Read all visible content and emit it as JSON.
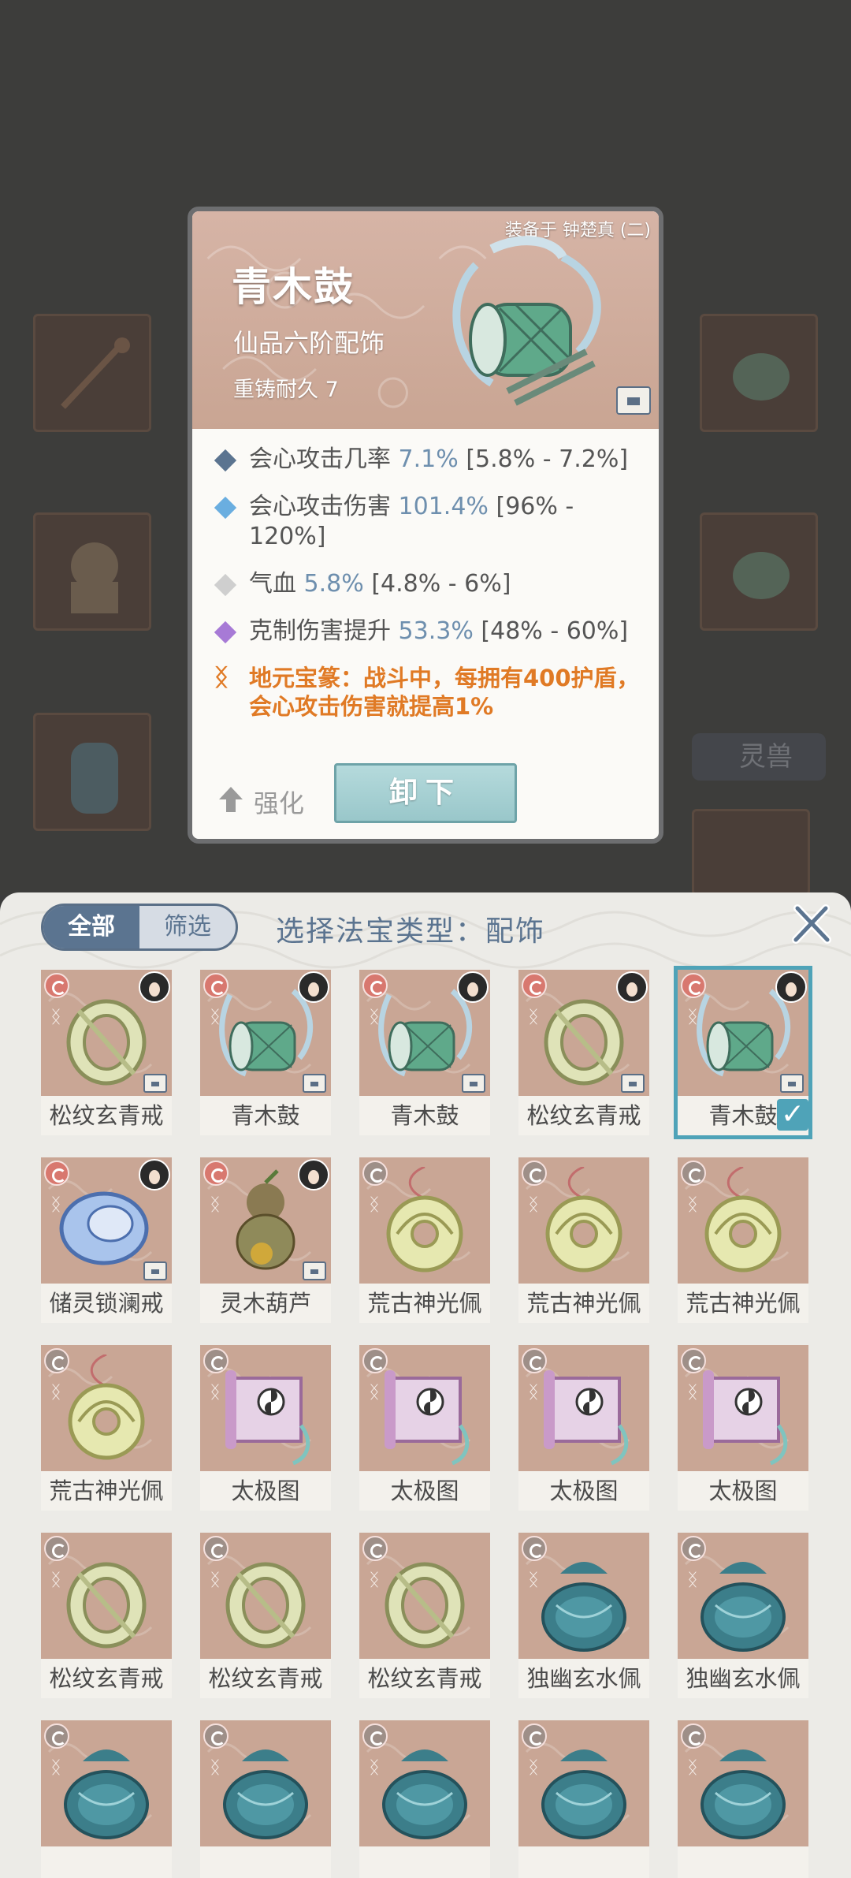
{
  "colors": {
    "accent_blue": "#5b7490",
    "stat_value_blue": "#6e8fae",
    "special_orange": "#e07a25",
    "selected_border": "#4fa3b8",
    "card_header": "#c9a593"
  },
  "background": {
    "beast_button_label": "灵兽"
  },
  "card": {
    "equipped_on": "装备于 钟楚真 (二)",
    "name": "青木鼓",
    "grade": "仙品六阶配饰",
    "durability": "重铸耐久 7",
    "stats": [
      {
        "name": "会心攻击几率",
        "value": "7.1%",
        "range": "[5.8% - 7.2%]",
        "gem": "#5b7490"
      },
      {
        "name": "会心攻击伤害",
        "value": "101.4%",
        "range": "[96% - 120%]",
        "gem": "#6aaee0"
      },
      {
        "name": "气血",
        "value": "5.8%",
        "range": "[4.8% - 6%]",
        "gem": "#cfcfcf"
      },
      {
        "name": "克制伤害提升",
        "value": "53.3%",
        "range": "[48% - 60%]",
        "gem": "#a77ad6"
      }
    ],
    "special_effect": "地元宝篆：战斗中，每拥有400护盾，会心攻击伤害就提高1%",
    "enhance_label": "强化",
    "unequip_label": "卸下"
  },
  "panel": {
    "tabs": [
      {
        "label": "全部",
        "active": true
      },
      {
        "label": "筛选",
        "active": false
      }
    ],
    "title": "选择法宝类型：配饰",
    "items": [
      {
        "name": "松纹玄青戒",
        "kind": "ring",
        "equipped": true,
        "locked": true,
        "selected": false
      },
      {
        "name": "青木鼓",
        "kind": "drum",
        "equipped": true,
        "locked": true,
        "selected": false
      },
      {
        "name": "青木鼓",
        "kind": "drum",
        "equipped": true,
        "locked": true,
        "selected": false
      },
      {
        "name": "松纹玄青戒",
        "kind": "ring",
        "equipped": true,
        "locked": true,
        "selected": false
      },
      {
        "name": "青木鼓",
        "kind": "drum",
        "equipped": true,
        "locked": true,
        "selected": true
      },
      {
        "name": "储灵锁澜戒",
        "kind": "bluering",
        "equipped": true,
        "locked": true,
        "selected": false
      },
      {
        "name": "灵木葫芦",
        "kind": "gourd",
        "equipped": true,
        "locked": true,
        "selected": false
      },
      {
        "name": "荒古神光佩",
        "kind": "pendant",
        "equipped": false,
        "locked": false,
        "selected": false
      },
      {
        "name": "荒古神光佩",
        "kind": "pendant",
        "equipped": false,
        "locked": false,
        "selected": false
      },
      {
        "name": "荒古神光佩",
        "kind": "pendant",
        "equipped": false,
        "locked": false,
        "selected": false
      },
      {
        "name": "荒古神光佩",
        "kind": "pendant",
        "equipped": false,
        "locked": false,
        "selected": false
      },
      {
        "name": "太极图",
        "kind": "scroll",
        "equipped": false,
        "locked": false,
        "selected": false
      },
      {
        "name": "太极图",
        "kind": "scroll",
        "equipped": false,
        "locked": false,
        "selected": false
      },
      {
        "name": "太极图",
        "kind": "scroll",
        "equipped": false,
        "locked": false,
        "selected": false
      },
      {
        "name": "太极图",
        "kind": "scroll",
        "equipped": false,
        "locked": false,
        "selected": false
      },
      {
        "name": "松纹玄青戒",
        "kind": "ring",
        "equipped": false,
        "locked": false,
        "selected": false
      },
      {
        "name": "松纹玄青戒",
        "kind": "ring",
        "equipped": false,
        "locked": false,
        "selected": false
      },
      {
        "name": "松纹玄青戒",
        "kind": "ring",
        "equipped": false,
        "locked": false,
        "selected": false
      },
      {
        "name": "独幽玄水佩",
        "kind": "jar",
        "equipped": false,
        "locked": false,
        "selected": false
      },
      {
        "name": "独幽玄水佩",
        "kind": "jar",
        "equipped": false,
        "locked": false,
        "selected": false
      },
      {
        "name": "",
        "kind": "jar",
        "equipped": false,
        "locked": false,
        "selected": false
      },
      {
        "name": "",
        "kind": "jar",
        "equipped": false,
        "locked": false,
        "selected": false
      },
      {
        "name": "",
        "kind": "jar",
        "equipped": false,
        "locked": false,
        "selected": false
      },
      {
        "name": "",
        "kind": "jar",
        "equipped": false,
        "locked": false,
        "selected": false
      },
      {
        "name": "",
        "kind": "jar",
        "equipped": false,
        "locked": false,
        "selected": false
      }
    ]
  }
}
